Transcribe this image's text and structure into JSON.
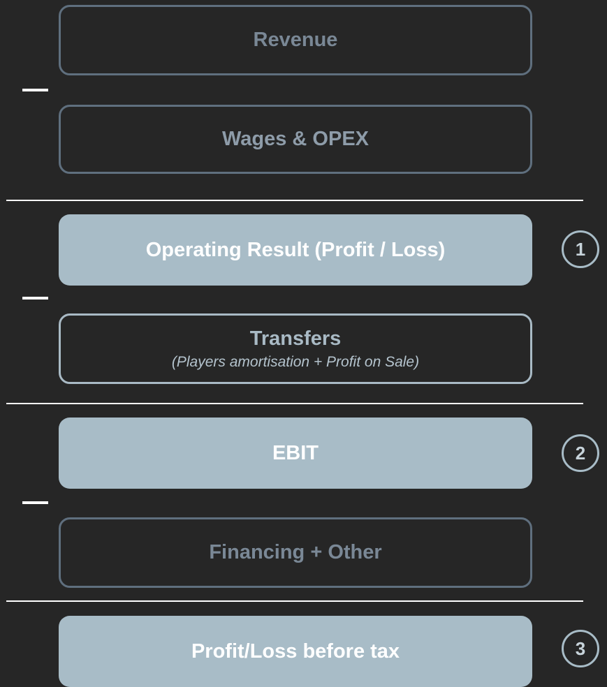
{
  "rows": [
    {
      "label": "Revenue"
    },
    {
      "label": "Wages & OPEX"
    },
    {
      "label": "Operating Result (Profit / Loss)",
      "step": "1"
    },
    {
      "label": "Transfers",
      "sublabel": "(Players amortisation + Profit on Sale)"
    },
    {
      "label": "EBIT",
      "step": "2"
    },
    {
      "label": "Financing + Other"
    },
    {
      "label": "Profit/Loss before tax",
      "step": "3"
    }
  ],
  "colors": {
    "background": "#262626",
    "box_fill": "#a8bcc7",
    "box_outline": "#5f6f7e",
    "divider": "#ffffff"
  }
}
